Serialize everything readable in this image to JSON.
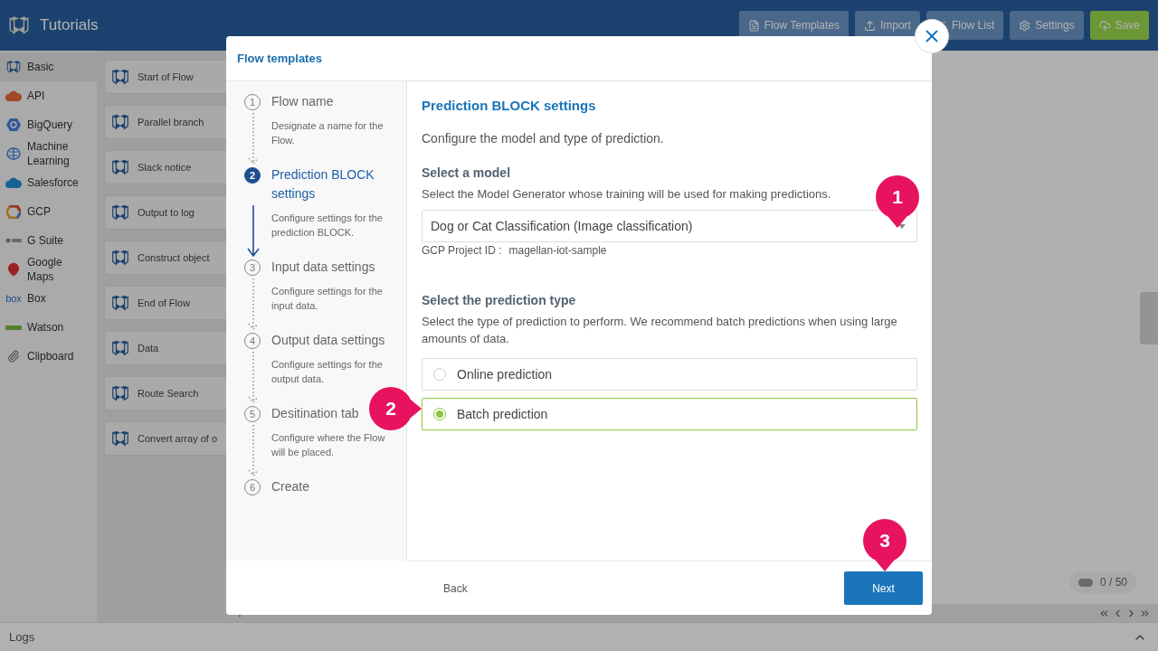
{
  "app": {
    "title": "Tutorials"
  },
  "toolbar": [
    {
      "label": "Flow Templates",
      "kind": "plain"
    },
    {
      "label": "Import",
      "kind": "plain"
    },
    {
      "label": "Flow List",
      "kind": "plain"
    },
    {
      "label": "Settings",
      "kind": "plain"
    },
    {
      "label": "Save",
      "kind": "primary"
    }
  ],
  "sidebar": {
    "items": [
      {
        "label": "Basic",
        "selected": true
      },
      {
        "label": "API",
        "selected": false
      },
      {
        "label": "BigQuery",
        "selected": false
      },
      {
        "label": "Machine Learning",
        "selected": false
      },
      {
        "label": "Salesforce",
        "selected": false
      },
      {
        "label": "GCP",
        "selected": false
      },
      {
        "label": "G Suite",
        "selected": false
      },
      {
        "label": "Google Maps",
        "selected": false
      },
      {
        "label": "Box",
        "badge": "box",
        "selected": false
      },
      {
        "label": "Watson",
        "selected": false
      },
      {
        "label": "Clipboard",
        "selected": false
      }
    ]
  },
  "blocks": [
    "Start of Flow",
    "Parallel branch",
    "Slack notice",
    "Output to log",
    "Construct object",
    "End of Flow",
    "Data",
    "Route Search",
    "Convert array of o"
  ],
  "canvas": {
    "counter": "0 / 50"
  },
  "logs": {
    "label": "Logs"
  },
  "dialog": {
    "title": "Flow templates",
    "steps": [
      {
        "number": "1",
        "title": "Flow name",
        "description": "Designate a name for the Flow.",
        "selected": false
      },
      {
        "number": "2",
        "title": "Prediction BLOCK settings",
        "description": "Configure settings for the prediction BLOCK.",
        "selected": true
      },
      {
        "number": "3",
        "title": "Input data settings",
        "description": "Configure settings for the input data.",
        "selected": false
      },
      {
        "number": "4",
        "title": "Output data settings",
        "description": "Configure settings for the output data.",
        "selected": false
      },
      {
        "number": "5",
        "title": "Desitination tab",
        "description": "Configure where the Flow will be placed.",
        "selected": false
      },
      {
        "number": "6",
        "title": "Create",
        "selected": false
      }
    ],
    "heading": "Prediction BLOCK settings",
    "intro": "Configure the model and type of prediction.",
    "model": {
      "label": "Select a model",
      "hint": "Select the Model Generator whose training will be used for making predictions.",
      "value": "Dog or Cat Classification (Image classification)",
      "project_label": "GCP Project ID :",
      "project_value": "magellan-iot-sample"
    },
    "prediction": {
      "label": "Select the prediction type",
      "hint": "Select the type of prediction to perform. We recommend batch predictions when using large amounts of data.",
      "options": [
        {
          "label": "Online prediction",
          "selected": false
        },
        {
          "label": "Batch prediction",
          "selected": true
        }
      ]
    },
    "buttons": {
      "back": "Back",
      "next": "Next"
    }
  },
  "markers": [
    "1",
    "2",
    "3"
  ]
}
